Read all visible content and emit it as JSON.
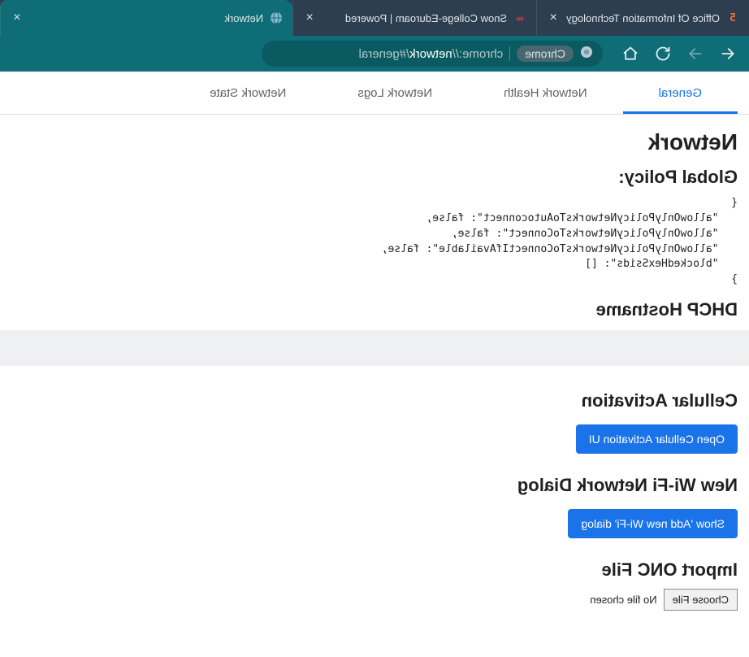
{
  "browser": {
    "tabs": [
      {
        "title": "Office Of Information Technology",
        "favicon": "5"
      },
      {
        "title": "Snow College-Eduroam | Powered",
        "favicon": "∞"
      },
      {
        "title": "Network",
        "favicon": "globe"
      }
    ],
    "address": {
      "chip": "Chrome",
      "url_prefix": "chrome://",
      "url_bold": "network",
      "url_suffix": "/#general"
    }
  },
  "tabs": [
    {
      "label": "General",
      "active": true
    },
    {
      "label": "Network Health",
      "active": false
    },
    {
      "label": "Network Logs",
      "active": false
    },
    {
      "label": "Network State",
      "active": false
    }
  ],
  "page": {
    "h1": "Network",
    "h2_policy": "Global Policy:",
    "policy_json": "{\n   \"allowOnlyPolicyNetworksToAutoconnect\": false,\n   \"allowOnlyPolicyNetworksToConnect\": false,\n   \"allowOnlyPolicyNetworksToConnectIfAvailable\": false,\n   \"blockedHexSsids\": []\n}",
    "h2_dhcp": "DHCP Hostname",
    "h2_cell": "Cellular Activation",
    "btn_cell": "Open Cellular Activation UI",
    "h2_wifi": "New Wi-Fi Network Dialog",
    "btn_wifi": "Show 'Add new Wi-Fi' dialog",
    "h2_onc": "Import ONC File",
    "file_btn": "Choose File",
    "file_label": "No file chosen"
  }
}
